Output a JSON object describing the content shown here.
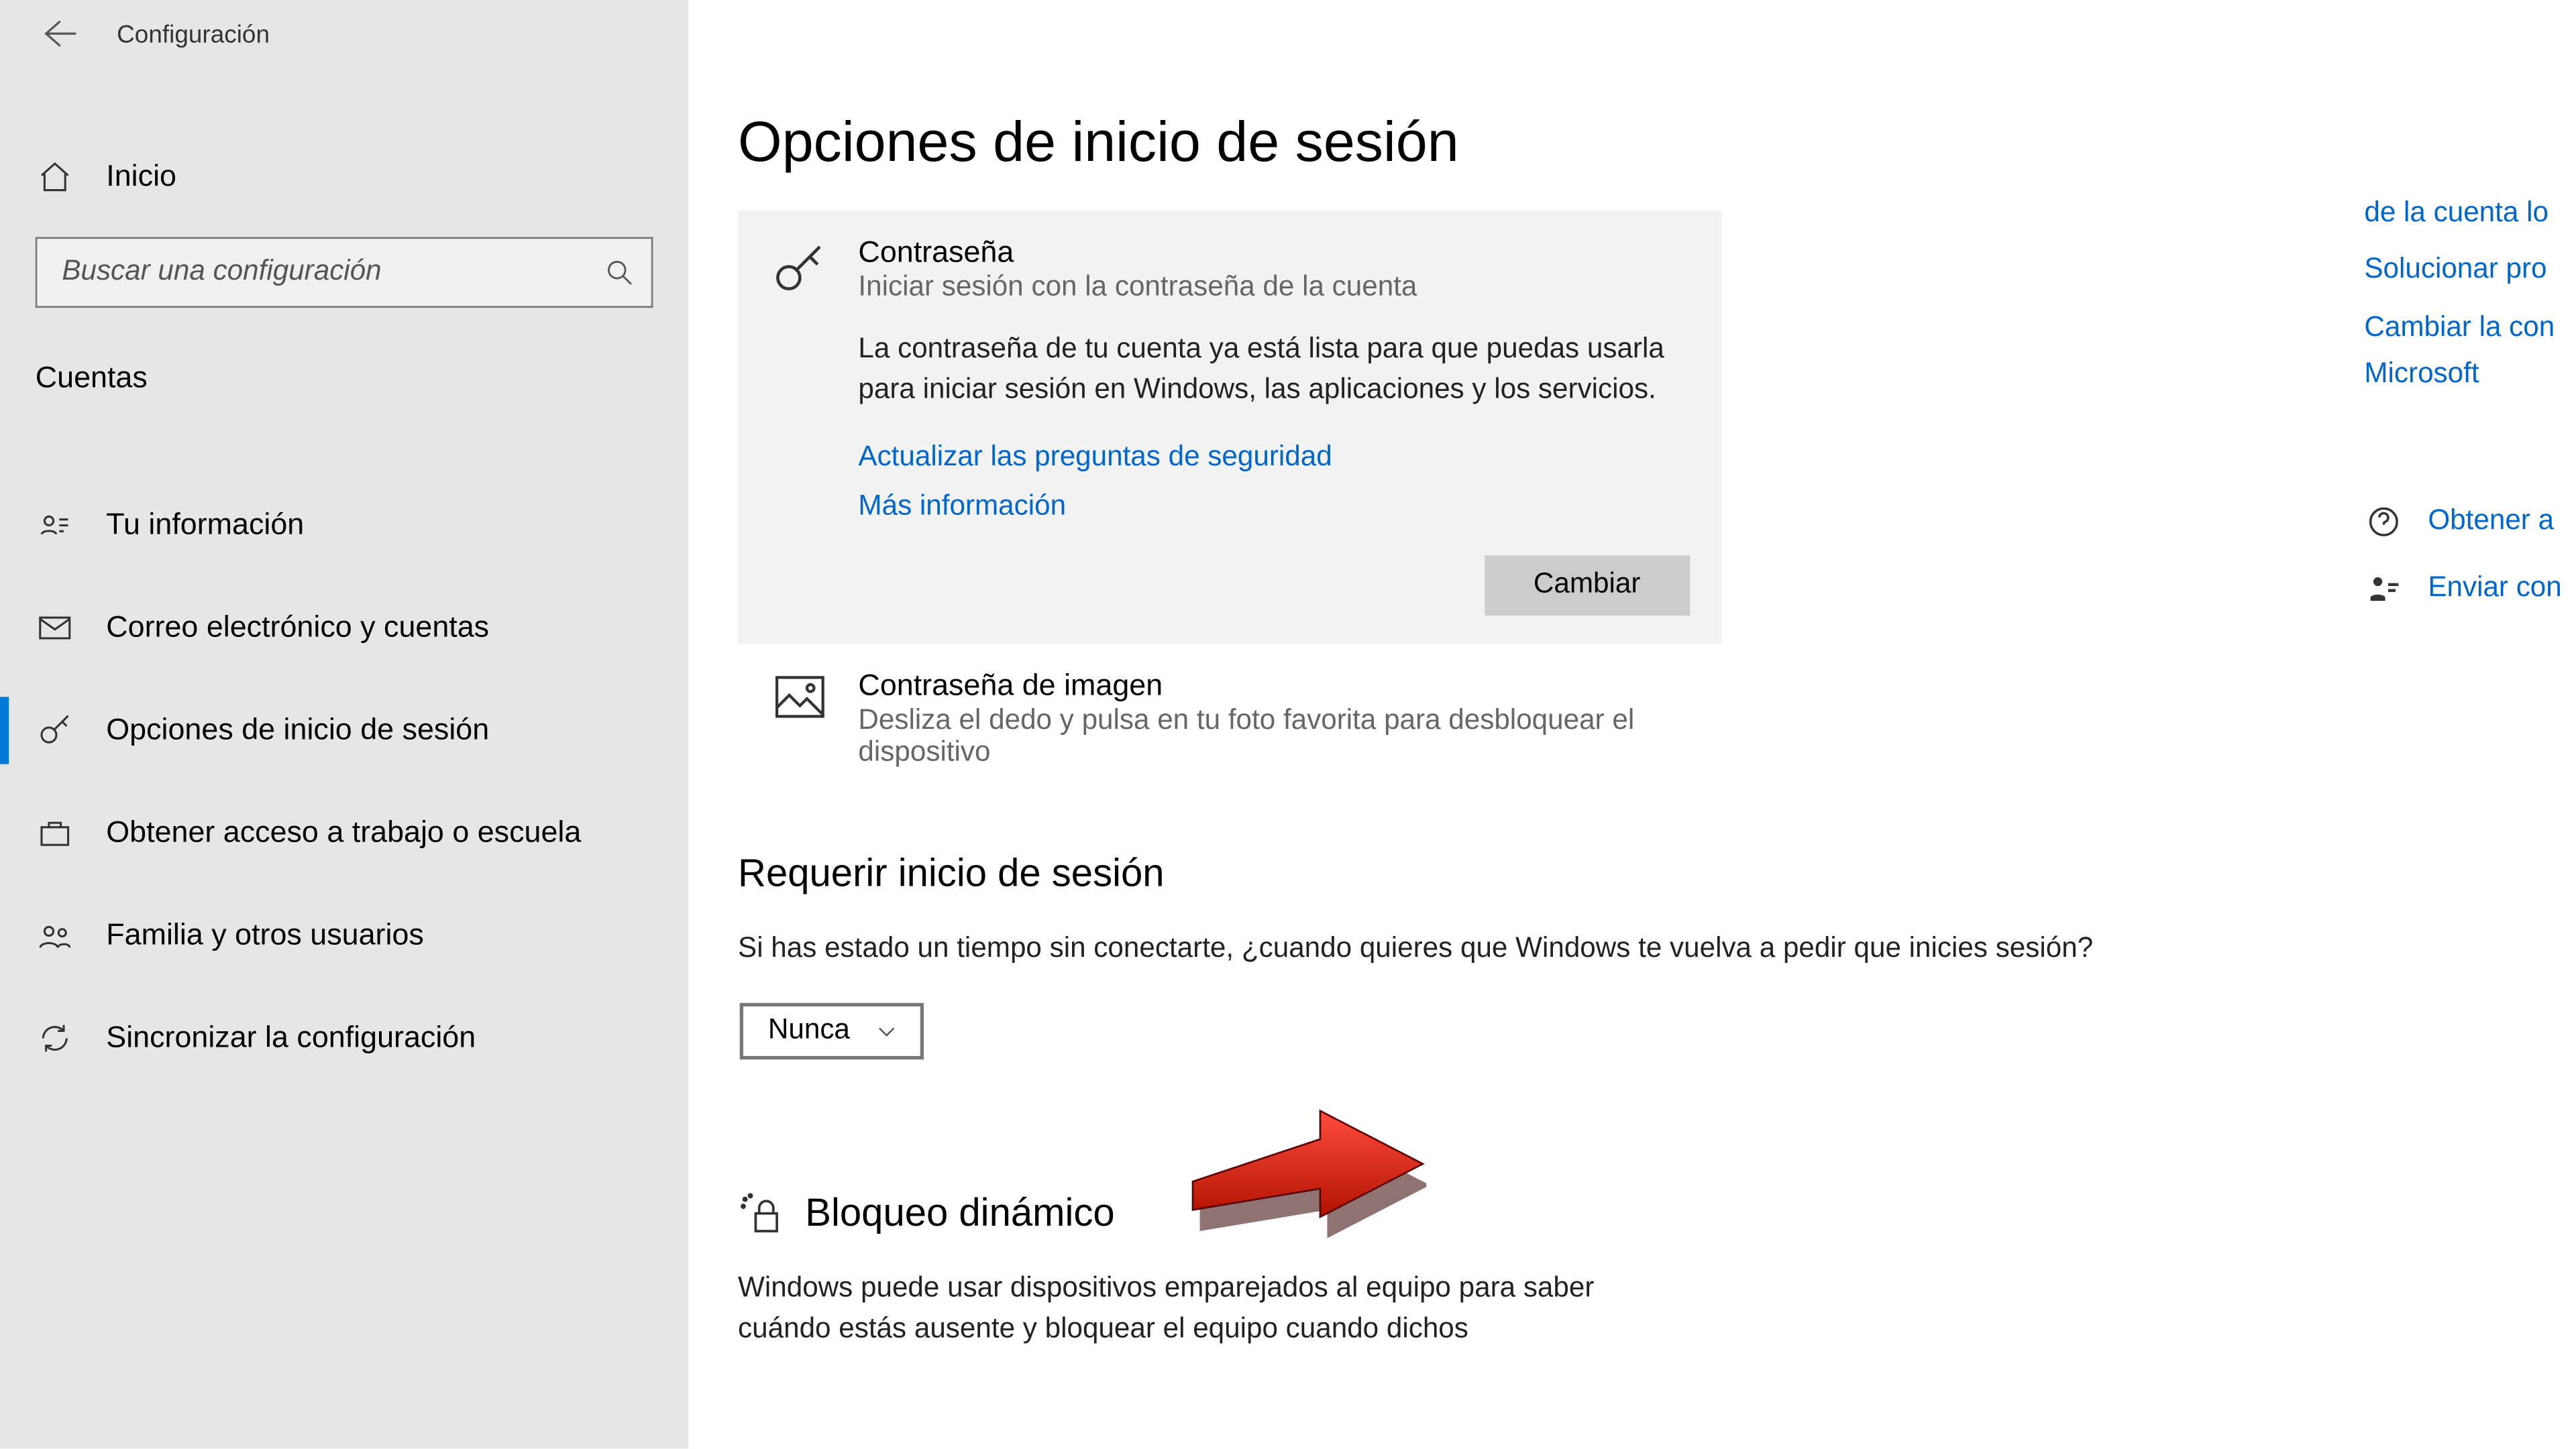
{
  "app": {
    "title": "Configuración"
  },
  "sidebar": {
    "home": "Inicio",
    "search_placeholder": "Buscar una configuración",
    "category": "Cuentas",
    "items": [
      {
        "label": "Tu información"
      },
      {
        "label": "Correo electrónico y cuentas"
      },
      {
        "label": "Opciones de inicio de sesión"
      },
      {
        "label": "Obtener acceso a trabajo o escuela"
      },
      {
        "label": "Familia y otros usuarios"
      },
      {
        "label": "Sincronizar la configuración"
      }
    ]
  },
  "main": {
    "title": "Opciones de inicio de sesión",
    "password": {
      "title": "Contraseña",
      "subtitle": "Iniciar sesión con la contraseña de la cuenta",
      "description": "La contraseña de tu cuenta ya está lista para que puedas usarla para iniciar sesión en Windows, las aplicaciones y los servicios.",
      "link_security_questions": "Actualizar las preguntas de seguridad",
      "link_more": "Más información",
      "change_button": "Cambiar"
    },
    "picture_password": {
      "title": "Contraseña de imagen",
      "subtitle": "Desliza el dedo y pulsa en tu foto favorita para desbloquear el dispositivo"
    },
    "require_signin": {
      "heading": "Requerir inicio de sesión",
      "description": "Si has estado un tiempo sin conectarte, ¿cuando quieres que Windows te vuelva a pedir que inicies sesión?",
      "selected": "Nunca"
    },
    "dynamic_lock": {
      "heading": "Bloqueo dinámico",
      "description": "Windows puede usar dispositivos emparejados al equipo para saber cuándo estás ausente y bloquear el equipo cuando dichos"
    }
  },
  "help": {
    "links": [
      "de la cuenta lo",
      "Solucionar pro",
      "Cambiar la con",
      "Microsoft"
    ],
    "rows": [
      "Obtener a",
      "Enviar con"
    ]
  }
}
